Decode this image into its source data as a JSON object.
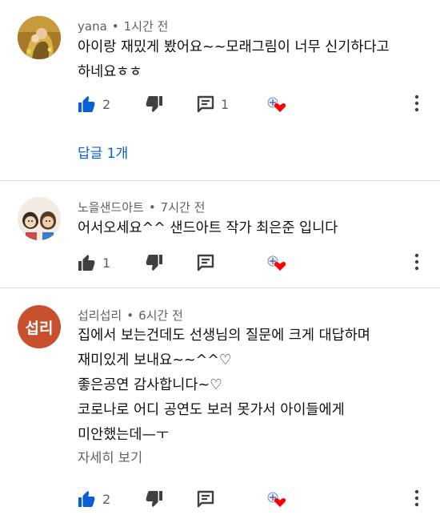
{
  "comments": [
    {
      "author": "yana",
      "time": "1시간 전",
      "lines": [
        "아이랑 재밌게 봤어요~~모래그림이 너무 신기하다고",
        "하네요ㅎㅎ"
      ],
      "likes": "2",
      "replies_count": "1",
      "replies_link": "답글 1개",
      "liked": true
    },
    {
      "author": "노을샌드아트",
      "time": "7시간 전",
      "lines": [
        "어서오세요^^ 샌드아트 작가 최은준 입니다"
      ],
      "likes": "1",
      "liked": false
    },
    {
      "author": "섭리섭리",
      "avatar_text": "섭리",
      "time": "6시간 전",
      "lines": [
        "집에서 보는건데도 선생님의 질문에 크게 대답하며",
        "재미있게 보내요~~^^♡",
        "좋은공연 감사합니다~♡",
        "코로나로 어디 공연도 보러 못가서 아이들에게",
        "미안했는데—ㅜ"
      ],
      "read_more": "자세히 보기",
      "likes": "2",
      "liked": true
    }
  ],
  "separator": "•",
  "colors": {
    "accent": "#065fd4",
    "heart": "#ff0000",
    "avatar_red": "#c9502e"
  },
  "icons": [
    "thumbs-up-icon",
    "thumbs-down-icon",
    "reply-icon",
    "creator-heart-icon",
    "more-vert-icon"
  ]
}
